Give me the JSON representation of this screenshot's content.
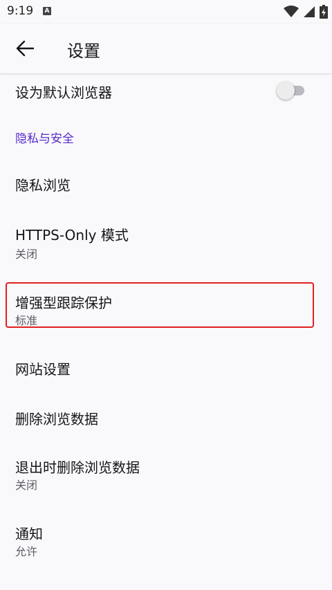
{
  "status_bar": {
    "time": "9:19",
    "notification_icon": "app-a-icon",
    "wifi_icon": "wifi-icon",
    "signal_icon": "signal-icon",
    "battery_icon": "battery-icon"
  },
  "app_bar": {
    "back_icon": "arrow-left-icon",
    "title": "设置"
  },
  "settings": {
    "default_browser": {
      "label": "设为默认浏览器",
      "toggle_on": false
    },
    "privacy_section": {
      "header": "隐私与安全"
    },
    "private_browsing": {
      "label": "隐私浏览"
    },
    "https_only": {
      "label": "HTTPS-Only 模式",
      "value": "关闭"
    },
    "tracking_protection": {
      "label": "增强型跟踪保护",
      "value": "标准"
    },
    "site_settings": {
      "label": "网站设置"
    },
    "delete_browsing_data": {
      "label": "删除浏览数据"
    },
    "delete_on_quit": {
      "label": "退出时删除浏览数据",
      "value": "关闭"
    },
    "notifications": {
      "label": "通知",
      "value": "允许"
    }
  },
  "colors": {
    "accent": "#592acb",
    "highlight": "#e02020",
    "background": "#f9f9fb"
  }
}
